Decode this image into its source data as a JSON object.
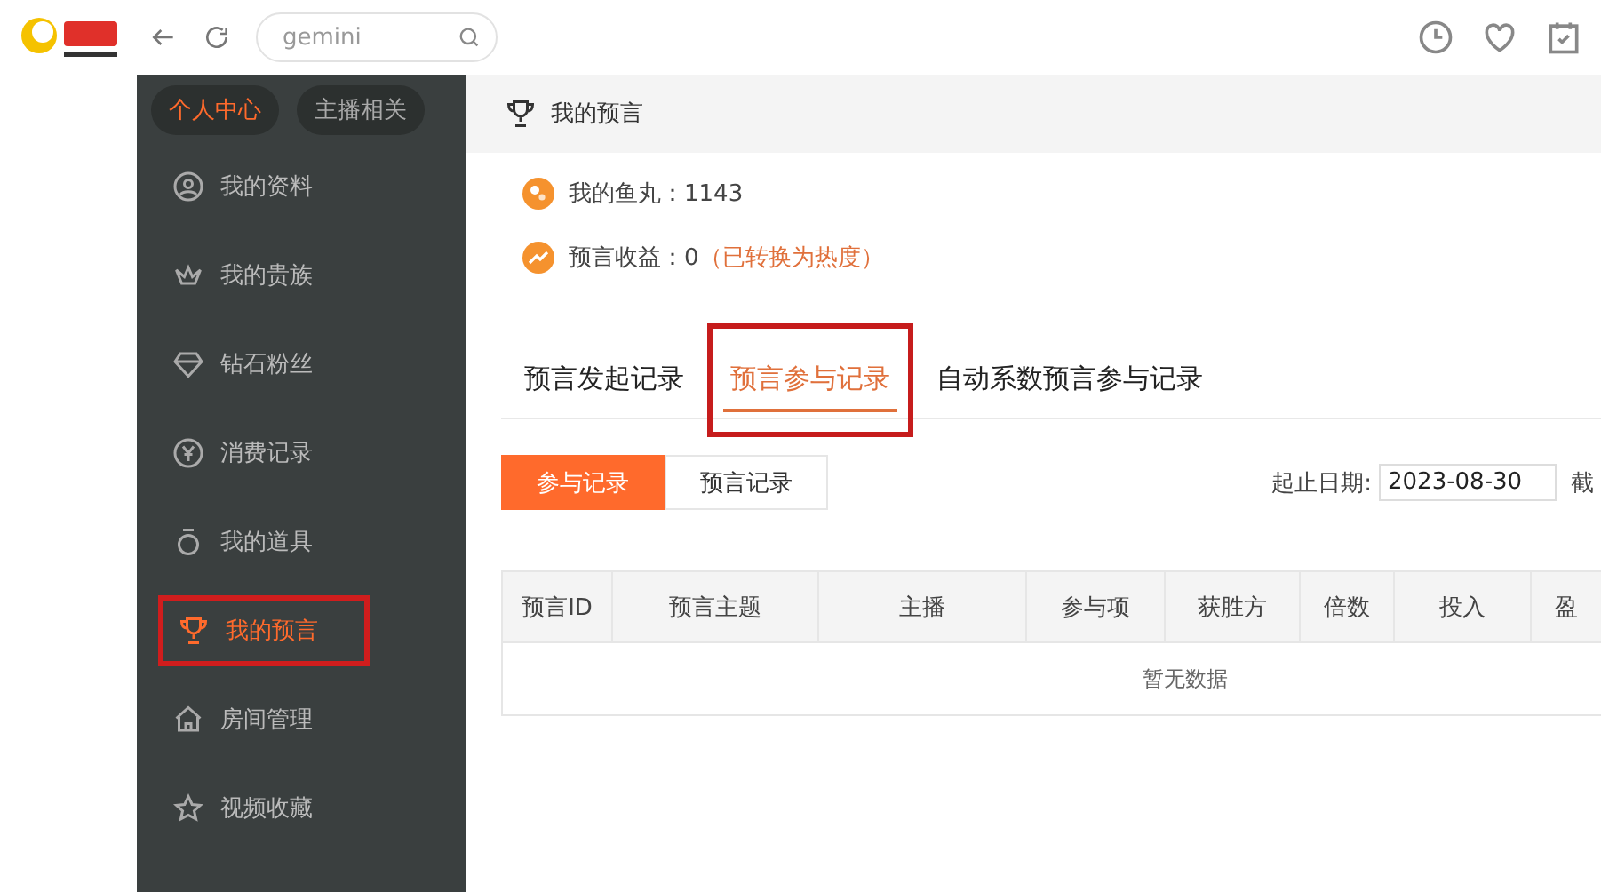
{
  "header": {
    "search": {
      "value": "gemini"
    }
  },
  "sidebar": {
    "switch": [
      {
        "label": "个人中心",
        "selected": true
      },
      {
        "label": "主播相关",
        "selected": false
      }
    ],
    "items": [
      {
        "label": "我的资料",
        "kind": "user",
        "selected": false,
        "highlighted": false
      },
      {
        "label": "我的贵族",
        "kind": "crown",
        "selected": false,
        "highlighted": false
      },
      {
        "label": "钻石粉丝",
        "kind": "diamond",
        "selected": false,
        "highlighted": false
      },
      {
        "label": "消费记录",
        "kind": "yen",
        "selected": false,
        "highlighted": false
      },
      {
        "label": "我的道具",
        "kind": "bag",
        "selected": false,
        "highlighted": false
      },
      {
        "label": "我的预言",
        "kind": "trophy",
        "selected": true,
        "highlighted": true
      },
      {
        "label": "房间管理",
        "kind": "home",
        "selected": false,
        "highlighted": false
      },
      {
        "label": "视频收藏",
        "kind": "star",
        "selected": false,
        "highlighted": false
      }
    ]
  },
  "breadcrumb": "我的预言",
  "stats": [
    {
      "label": "我的鱼丸：1143",
      "kind": "coin"
    },
    {
      "label": "预言收益：0",
      "note": "（已转换为热度）",
      "kind": "trend"
    }
  ],
  "tabs": [
    {
      "label": "预言发起记录",
      "selected": false,
      "highlighted": false
    },
    {
      "label": "预言参与记录",
      "selected": true,
      "highlighted": true
    },
    {
      "label": "自动系数预言参与记录",
      "selected": false,
      "highlighted": false
    }
  ],
  "subtabs": [
    {
      "label": "参与记录",
      "selected": true
    },
    {
      "label": "预言记录",
      "selected": false
    }
  ],
  "date_filter": {
    "label": "起止日期:",
    "value": "2023-08-30",
    "next_label": "截"
  },
  "table": {
    "columns": [
      "预言ID",
      "预言主题",
      "主播",
      "参与项",
      "获胜方",
      "倍数",
      "投入",
      "盈"
    ],
    "empty": "暂无数据"
  }
}
